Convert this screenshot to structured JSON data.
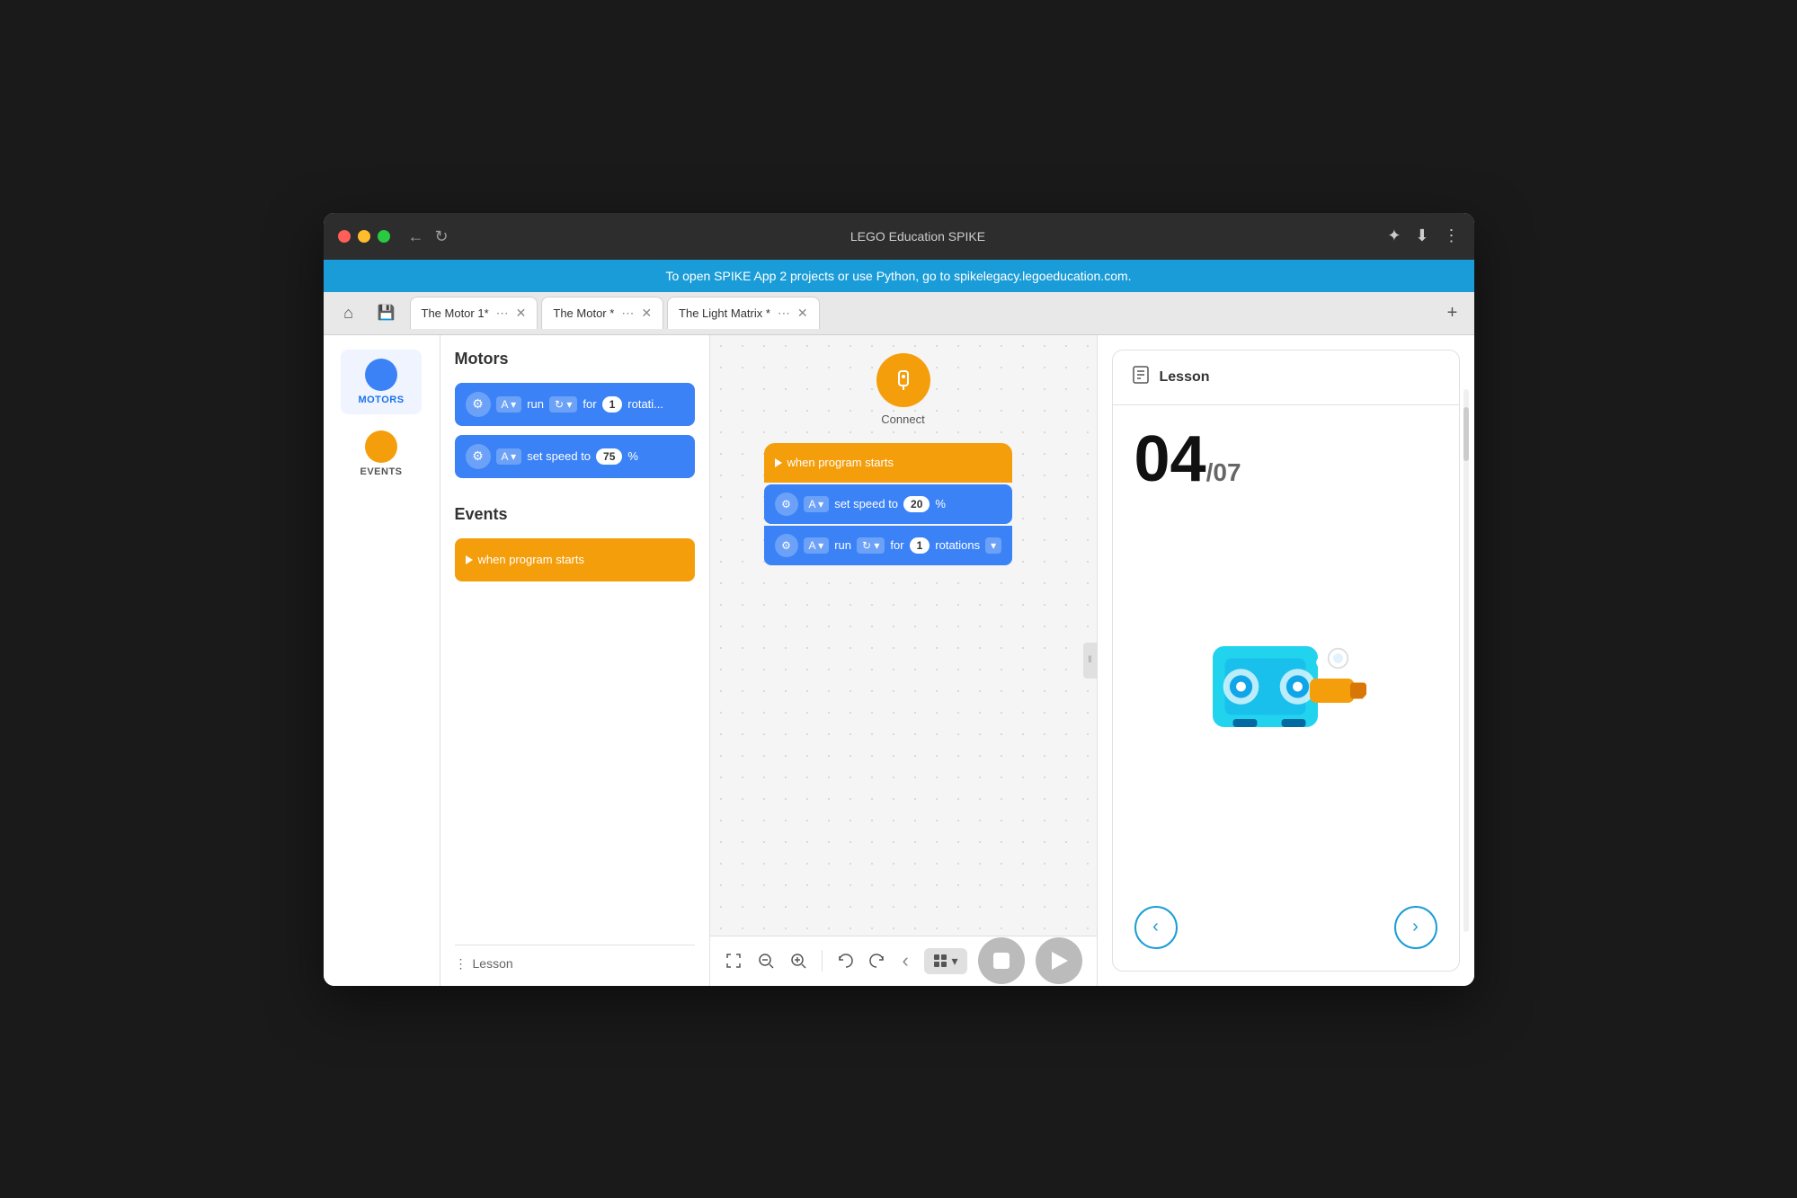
{
  "window": {
    "title": "LEGO Education SPIKE"
  },
  "banner": {
    "text": "To open SPIKE App 2 projects or use Python, go to spikelegacy.legoeducation.com."
  },
  "tabs": [
    {
      "label": "The Motor 1*",
      "active": true
    },
    {
      "label": "The Motor *",
      "active": false
    },
    {
      "label": "The Light Matrix *",
      "active": false
    }
  ],
  "sidebar": {
    "items": [
      {
        "id": "motors",
        "label": "MOTORS",
        "color": "#3b82f6",
        "active": true
      },
      {
        "id": "events",
        "label": "EVENTS",
        "color": "#f59e0b",
        "active": false
      }
    ]
  },
  "blocks_panel": {
    "motors_title": "Motors",
    "events_title": "Events",
    "motor_run_block": {
      "port": "A",
      "action": "run",
      "for_label": "for",
      "value": "1",
      "unit": "rotati..."
    },
    "motor_speed_block": {
      "port": "A",
      "action": "set speed to",
      "value": "75",
      "unit": "%"
    },
    "when_program_starts_block": {
      "label": "when program starts"
    },
    "lesson_label": "Lesson"
  },
  "connect": {
    "label": "Connect"
  },
  "canvas_blocks": {
    "when_starts": "when program starts",
    "set_speed": {
      "port": "A",
      "action": "set speed to",
      "value": "20",
      "unit": "%"
    },
    "run_block": {
      "port": "A",
      "action": "run",
      "for_label": "for",
      "value": "1",
      "unit": "rotations"
    }
  },
  "toolbar": {
    "fit_icon": "⤢",
    "zoom_out_icon": "−",
    "zoom_in_icon": "+",
    "undo_icon": "↩",
    "redo_icon": "↪",
    "back_icon": "‹",
    "stop_label": "Stop",
    "play_label": "Play"
  },
  "lesson": {
    "header_icon": "≡",
    "title": "Lesson",
    "page_current": "04",
    "page_separator": "/",
    "page_total": "07",
    "nav_prev": "‹",
    "nav_next": "›"
  }
}
